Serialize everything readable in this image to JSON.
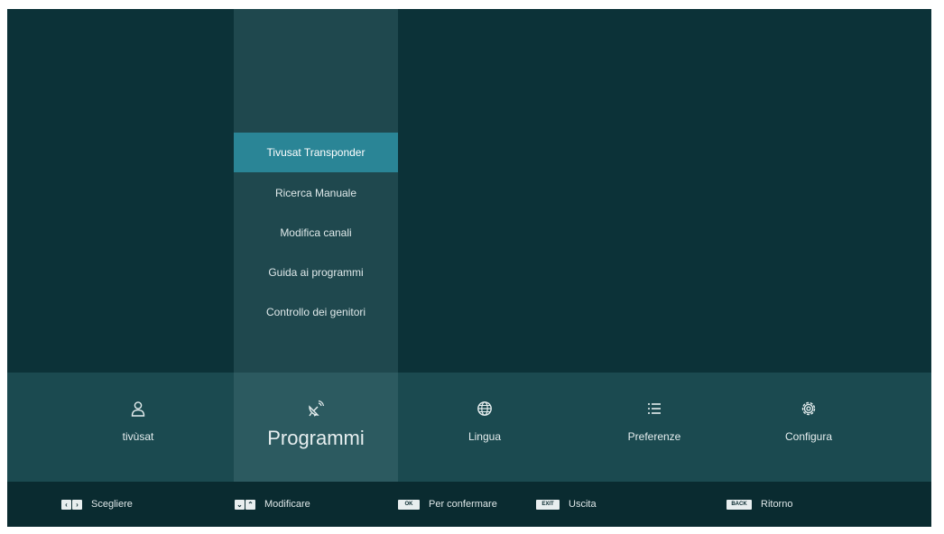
{
  "submenu": {
    "items": [
      {
        "label": "Tivusat Transponder",
        "selected": true
      },
      {
        "label": "Ricerca Manuale",
        "selected": false
      },
      {
        "label": "Modifica canali",
        "selected": false
      },
      {
        "label": "Guida ai programmi",
        "selected": false
      },
      {
        "label": "Controllo dei genitori",
        "selected": false
      }
    ]
  },
  "categories": [
    {
      "label": "tivùsat",
      "icon": "user-icon"
    },
    {
      "label": "Programmi",
      "icon": "satellite-dish-icon",
      "active": true
    },
    {
      "label": "Lingua",
      "icon": "globe-icon"
    },
    {
      "label": "Preferenze",
      "icon": "list-icon"
    },
    {
      "label": "Configura",
      "icon": "gear-icon"
    }
  ],
  "hints": [
    {
      "key": "‹ ›",
      "label": "Scegliere"
    },
    {
      "key": "⌄ ⌃",
      "label": "Modificare"
    },
    {
      "key": "OK",
      "label": "Per confermare"
    },
    {
      "key": "EXIT",
      "label": "Uscita"
    },
    {
      "key": "BACK",
      "label": "Ritorno"
    }
  ],
  "colors": {
    "background": "#0c3238",
    "submenu_column": "#1f484e",
    "selected_item": "#2a8596",
    "category_bar": "#1b4a50",
    "active_category": "#2c5a60",
    "hint_bar": "#0a2b30"
  }
}
